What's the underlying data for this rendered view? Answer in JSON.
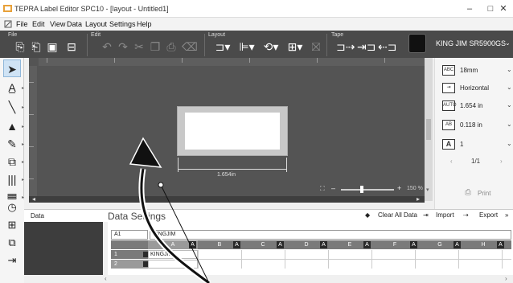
{
  "window": {
    "title": "TEPRA Label Editor SPC10 - [layout - Untitled1]",
    "minimize": "–",
    "maximize": "□",
    "close": "✕"
  },
  "menu": [
    "File",
    "Edit",
    "View",
    "Data",
    "Layout",
    "Settings",
    "Help"
  ],
  "ribbon": {
    "groups": {
      "file": "File",
      "edit": "Edit",
      "layout": "Layout",
      "tape": "Tape"
    },
    "printer_name": "KING JIM SR5900GS"
  },
  "canvas": {
    "dimension_label": "1.654in",
    "zoom_minus": "–",
    "zoom_plus": "+",
    "zoom_value": "150 %",
    "fit_icon": "⛶"
  },
  "right_panel": {
    "tape_width": "18mm",
    "orientation": "Horizontal",
    "length": "1.654 in",
    "margin": "0.118 in",
    "copies": "1",
    "page": "1/1",
    "print_label": "Print",
    "icons": {
      "tape": "ABC",
      "auto": "AUTO",
      "margin": "AB"
    }
  },
  "data_panel": {
    "title": "Data",
    "settings_title": "Data Settings",
    "clear_all": "Clear All Data",
    "import": "Import",
    "export": "Export",
    "cell_ref": "A1",
    "formula_value": "KINGJIM",
    "columns": [
      "A",
      "B",
      "C",
      "D",
      "E",
      "F",
      "G",
      "H"
    ],
    "col_marker": "A",
    "rows": [
      {
        "num": "1",
        "value": "KINGJIM"
      },
      {
        "num": "2",
        "value": ""
      }
    ]
  }
}
